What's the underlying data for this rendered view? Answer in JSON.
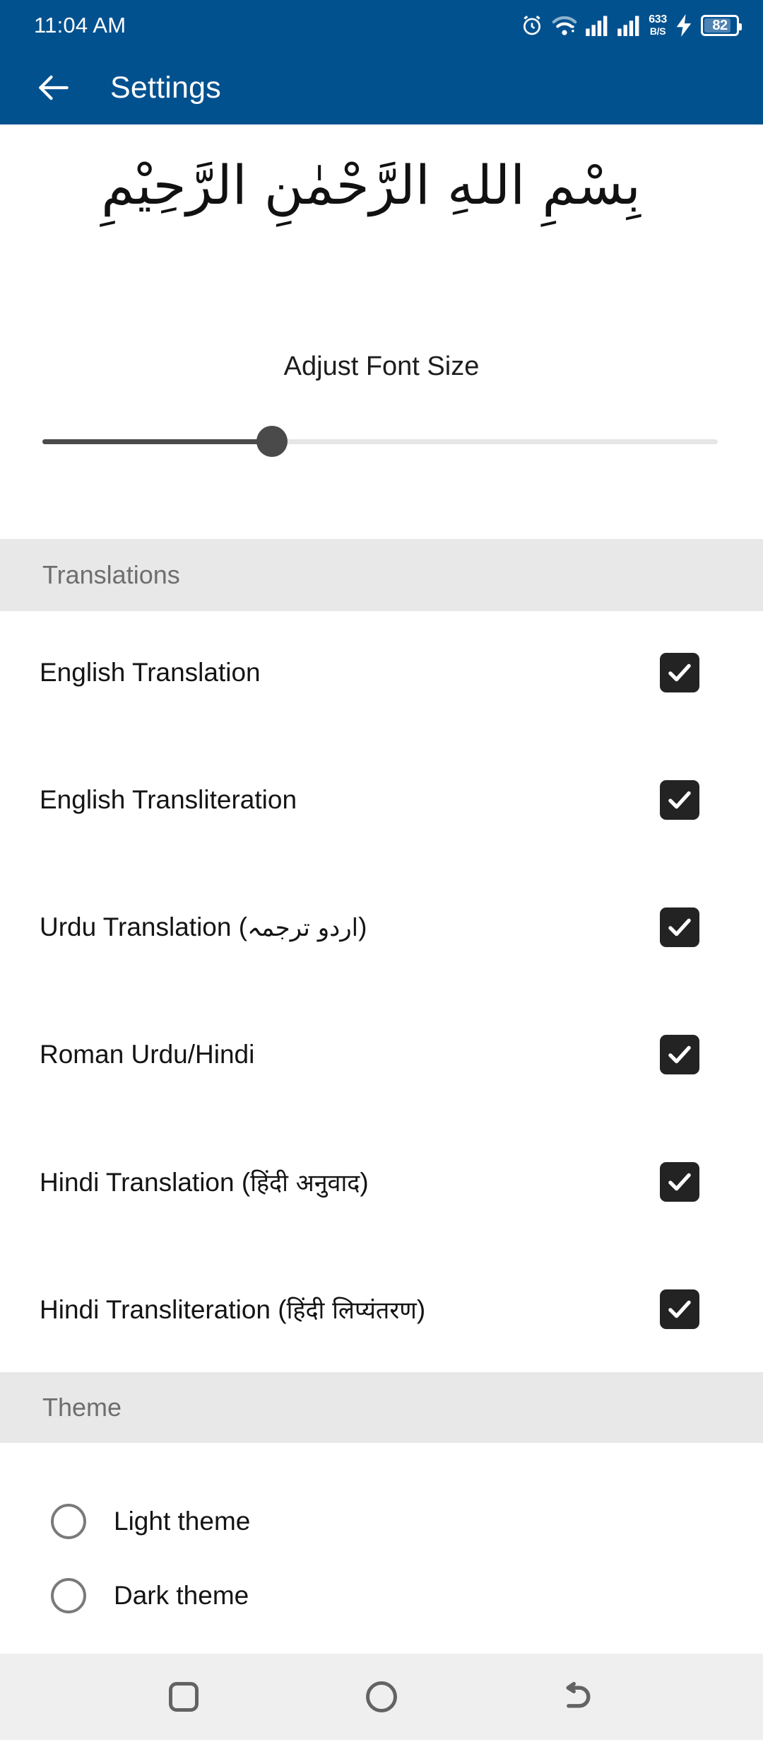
{
  "status_bar": {
    "time": "11:04 AM",
    "network_speed_value": "633",
    "network_speed_unit": "B/S",
    "battery_percent": "82",
    "icons": [
      "alarm-icon",
      "wifi-icon",
      "signal-sim1-icon",
      "signal-sim2-icon",
      "charging-bolt-icon",
      "battery-icon"
    ],
    "background_color": "#02518F"
  },
  "app_bar": {
    "title": "Settings",
    "back_icon": "arrow-left-icon",
    "background_color": "#02518F",
    "text_color": "#FFFFFF"
  },
  "bismillah": {
    "text": "بِسْمِ اللهِ الرَّحْمٰنِ الرَّحِيْمِ"
  },
  "font_size": {
    "label": "Adjust Font Size",
    "value_percent": "34",
    "track_color": "#E6E6E6",
    "fill_color": "#4A4A4A"
  },
  "sections": {
    "translations": {
      "header": "Translations",
      "items": [
        {
          "label": "English Translation",
          "native": "",
          "checked": true
        },
        {
          "label": "English Transliteration",
          "native": "",
          "checked": true
        },
        {
          "label": "Urdu Translation (",
          "native": "اردو ترجمہ",
          "suffix": ")",
          "checked": true
        },
        {
          "label": "Roman Urdu/Hindi",
          "native": "",
          "checked": true
        },
        {
          "label": "Hindi Translation (",
          "native": "हिंदी अनुवाद",
          "suffix": ")",
          "checked": true
        },
        {
          "label": "Hindi Transliteration (",
          "native": "हिंदी लिप्यंतरण",
          "suffix": ")",
          "checked": true
        }
      ]
    },
    "theme": {
      "header": "Theme",
      "options": [
        {
          "label": "Light theme",
          "selected": false
        },
        {
          "label": "Dark theme",
          "selected": false
        }
      ]
    }
  },
  "nav_bar": {
    "buttons": [
      {
        "name": "recents-button",
        "icon": "rounded-square-icon"
      },
      {
        "name": "home-button",
        "icon": "circle-icon"
      },
      {
        "name": "back-button",
        "icon": "u-turn-arrow-icon"
      }
    ],
    "background_color": "#EFEFEF"
  }
}
